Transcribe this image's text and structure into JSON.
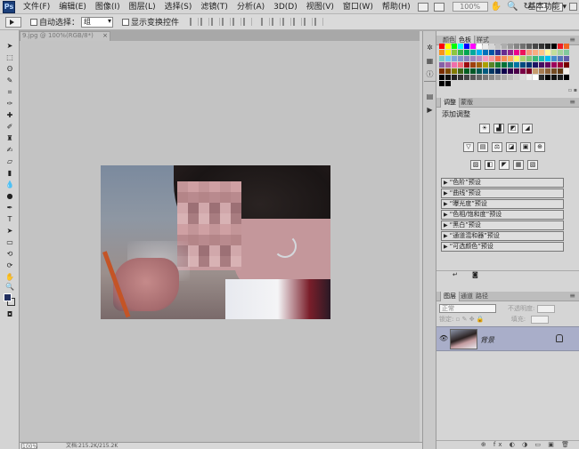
{
  "app": {
    "logo": "Ps"
  },
  "menubar": {
    "items": [
      "文件(F)",
      "编辑(E)",
      "图像(I)",
      "图层(L)",
      "选择(S)",
      "滤镜(T)",
      "分析(A)",
      "3D(D)",
      "视图(V)",
      "窗口(W)",
      "帮助(H)"
    ],
    "zoom": "100%",
    "workspace": "基本功能 ▾"
  },
  "options": {
    "auto_select_label": "自动选择：",
    "auto_select_value": "组",
    "show_transform_label": "显示变换控件"
  },
  "document": {
    "tab_title": "9.jpg @ 100%(RGB/8*)",
    "tab_close": "×",
    "status_zoom": "100%",
    "status_info": "文档:215.2K/215.2K"
  },
  "swatches": {
    "tabs": [
      "颜色",
      "色板",
      "样式"
    ],
    "colors": [
      "#ff0000",
      "#ffff00",
      "#00ff00",
      "#00ffff",
      "#0000ff",
      "#ff00ff",
      "#ffffff",
      "#ebebeb",
      "#d6d6d6",
      "#c2c2c2",
      "#adadad",
      "#999999",
      "#858585",
      "#707070",
      "#5c5c5c",
      "#474747",
      "#333333",
      "#1f1f1f",
      "#000000",
      "#ed1c24",
      "#f26522",
      "#f7941d",
      "#fff200",
      "#8dc63f",
      "#39b54a",
      "#00a651",
      "#00a99d",
      "#00aeef",
      "#0072bc",
      "#0054a6",
      "#2e3192",
      "#662d91",
      "#92278f",
      "#ec008c",
      "#ed145b",
      "#f7977a",
      "#f9ad81",
      "#fdc68a",
      "#fff79a",
      "#c4df9b",
      "#a3d39c",
      "#82ca9d",
      "#7accc8",
      "#6dcff6",
      "#7da7d9",
      "#8393ca",
      "#8781bd",
      "#a186be",
      "#bd8cbf",
      "#f49ac1",
      "#f6989d",
      "#f26c4f",
      "#f68e55",
      "#fbaf5d",
      "#fff467",
      "#acd372",
      "#7cc576",
      "#3bb878",
      "#1abbb4",
      "#00bff3",
      "#438ccb",
      "#5574b9",
      "#605ca8",
      "#8560a8",
      "#a864a8",
      "#f06eaa",
      "#f26d7d",
      "#9e0b0f",
      "#a0410d",
      "#a3620a",
      "#aba000",
      "#598527",
      "#197b30",
      "#007236",
      "#00746b",
      "#0076a3",
      "#004b80",
      "#003471",
      "#1b1464",
      "#440e62",
      "#630460",
      "#9e005d",
      "#9e0039",
      "#790000",
      "#7b2e00",
      "#7d4900",
      "#827b00",
      "#406618",
      "#005e20",
      "#005826",
      "#005952",
      "#005b7f",
      "#003663",
      "#002157",
      "#0d004c",
      "#32004b",
      "#4b0049",
      "#7b0046",
      "#7a0026",
      "#c69c6d",
      "#a67c52",
      "#8c6239",
      "#754c24",
      "#603913",
      "#f4efe8",
      "#000000",
      "#111111",
      "#222222",
      "#333333",
      "#444444",
      "#555555",
      "#666666",
      "#777777",
      "#888888",
      "#999999",
      "#aaaaaa",
      "#bbbbbb",
      "#cccccc",
      "#dddddd",
      "#eeeeee",
      "#ffffff",
      "#2d2d2d",
      "#000000",
      "#121212",
      "#1e1e1e",
      "#000000",
      "#000000",
      "#000000"
    ]
  },
  "adjustments": {
    "tabs": [
      "调整",
      "蒙版"
    ],
    "title": "添加调整",
    "icons_row1": [
      "☀",
      "▟",
      "◩",
      "◢"
    ],
    "icons_row2": [
      "▽",
      "▤",
      "⚖",
      "◪",
      "▣",
      "⊕"
    ],
    "icons_row3": [
      "▨",
      "◧",
      "◤",
      "▦",
      "▧"
    ],
    "presets": [
      "“色阶”预设",
      "“曲线”预设",
      "“曝光度”预设",
      "“色相/饱和度”预设",
      "“黑白”预设",
      "“通道混和器”预设",
      "“可选颜色”预设"
    ]
  },
  "layers": {
    "tabs": [
      "图层",
      "通道",
      "路径"
    ],
    "blend_mode": "正常",
    "opacity_label": "不透明度:",
    "lock_label": "锁定:",
    "fill_label": "填充:",
    "layer_name": "背景",
    "footer_icons": "⊕ fx ◐ ◑ ▭ ▣ 🗑"
  }
}
